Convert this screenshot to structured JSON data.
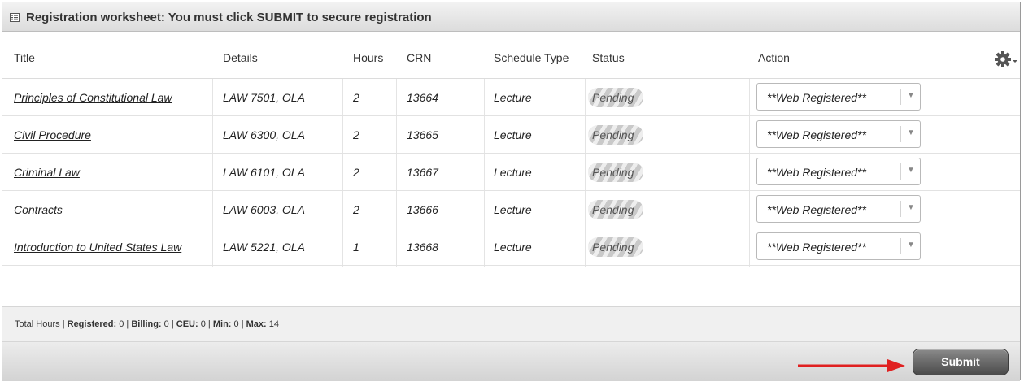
{
  "panel": {
    "title": "Registration worksheet: You must click SUBMIT to secure registration",
    "title_icon": "worksheet-icon"
  },
  "columns": {
    "title": "Title",
    "details": "Details",
    "hours": "Hours",
    "crn": "CRN",
    "schedule_type": "Schedule Type",
    "status": "Status",
    "action": "Action"
  },
  "settings_icon": "gear-icon",
  "rows": [
    {
      "title": "Principles of Constitutional Law",
      "details": "LAW 7501, OLA",
      "hours": "2",
      "crn": "13664",
      "schedule_type": "Lecture",
      "status": "Pending",
      "action": "**Web Registered**"
    },
    {
      "title": "Civil Procedure",
      "details": "LAW 6300, OLA",
      "hours": "2",
      "crn": "13665",
      "schedule_type": "Lecture",
      "status": "Pending",
      "action": "**Web Registered**"
    },
    {
      "title": "Criminal Law",
      "details": "LAW 6101, OLA",
      "hours": "2",
      "crn": "13667",
      "schedule_type": "Lecture",
      "status": "Pending",
      "action": "**Web Registered**"
    },
    {
      "title": "Contracts",
      "details": "LAW 6003, OLA",
      "hours": "2",
      "crn": "13666",
      "schedule_type": "Lecture",
      "status": "Pending",
      "action": "**Web Registered**"
    },
    {
      "title": "Introduction to United States Law",
      "details": "LAW 5221, OLA",
      "hours": "1",
      "crn": "13668",
      "schedule_type": "Lecture",
      "status": "Pending",
      "action": "**Web Registered**"
    }
  ],
  "totals": {
    "label": "Total Hours",
    "registered_label": "Registered:",
    "registered": "0",
    "billing_label": "Billing:",
    "billing": "0",
    "ceu_label": "CEU:",
    "ceu": "0",
    "min_label": "Min:",
    "min": "0",
    "max_label": "Max:",
    "max": "14"
  },
  "footer": {
    "submit_label": "Submit",
    "arrow_color": "#e02020"
  },
  "colors": {
    "submit_bg": "#5a5a5a",
    "annotation_arrow": "#e02020"
  }
}
